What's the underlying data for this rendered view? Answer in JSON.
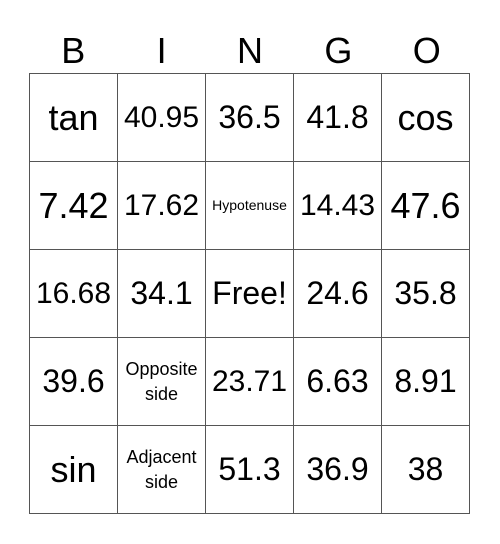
{
  "header": [
    "B",
    "I",
    "N",
    "G",
    "O"
  ],
  "rows": [
    [
      "tan",
      "40.95",
      "36.5",
      "41.8",
      "cos"
    ],
    [
      "7.42",
      "17.62",
      "Hypotenuse",
      "14.43",
      "47.6"
    ],
    [
      "16.68",
      "34.1",
      "Free!",
      "24.6",
      "35.8"
    ],
    [
      "39.6",
      "Opposite side",
      "23.71",
      "6.63",
      "8.91"
    ],
    [
      "sin",
      "Adjacent side",
      "51.3",
      "36.9",
      "38"
    ]
  ]
}
